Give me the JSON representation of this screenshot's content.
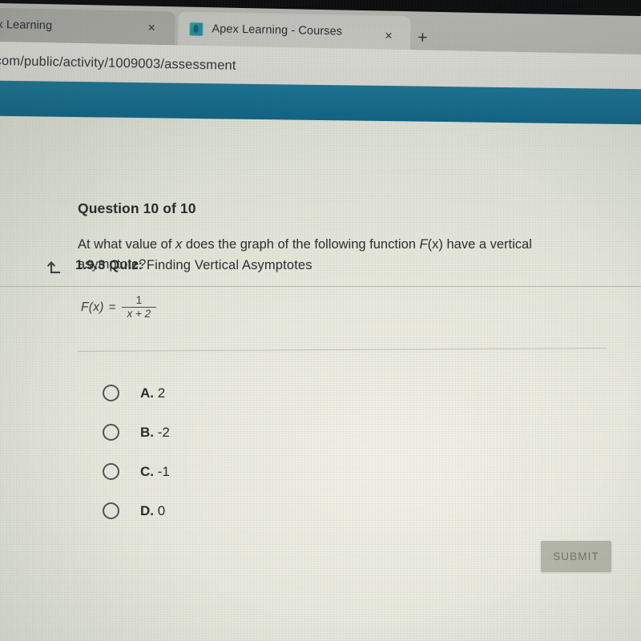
{
  "browser": {
    "tabs": [
      {
        "title": "x Learning",
        "favicon": "none",
        "active": false,
        "close_label": "×"
      },
      {
        "title": "Apex Learning - Courses",
        "favicon": "apex-favicon",
        "active": true,
        "close_label": "×"
      }
    ],
    "new_tab_label": "+",
    "url": "com/public/activity/1009003/assessment"
  },
  "header": {
    "band_color": "#14698a",
    "back_icon": "return-arrow-icon",
    "lesson_number": "1.9.3",
    "lesson_kind": "Quiz:",
    "lesson_title": "Finding Vertical Asymptotes"
  },
  "question": {
    "counter": "Question 10 of 10",
    "prompt_part1": "At what value of ",
    "prompt_var1": "x",
    "prompt_part2": " does the graph of the following function ",
    "prompt_var2": "F",
    "prompt_var2b": "(x)",
    "prompt_part3": " have a vertical asymptote?",
    "formula": {
      "lhs": "F(x)",
      "equals": "=",
      "numerator": "1",
      "denominator": "x + 2"
    }
  },
  "choices": [
    {
      "letter": "A.",
      "value": "2",
      "selected": false
    },
    {
      "letter": "B.",
      "value": "-2",
      "selected": false
    },
    {
      "letter": "C.",
      "value": "-1",
      "selected": false
    },
    {
      "letter": "D.",
      "value": "0",
      "selected": false
    }
  ],
  "submit": {
    "label": "SUBMIT",
    "enabled": false,
    "bg_color": "#b4b6aa",
    "text_color": "#6f736c"
  },
  "page": {
    "background_color": "#dfe1d6"
  }
}
